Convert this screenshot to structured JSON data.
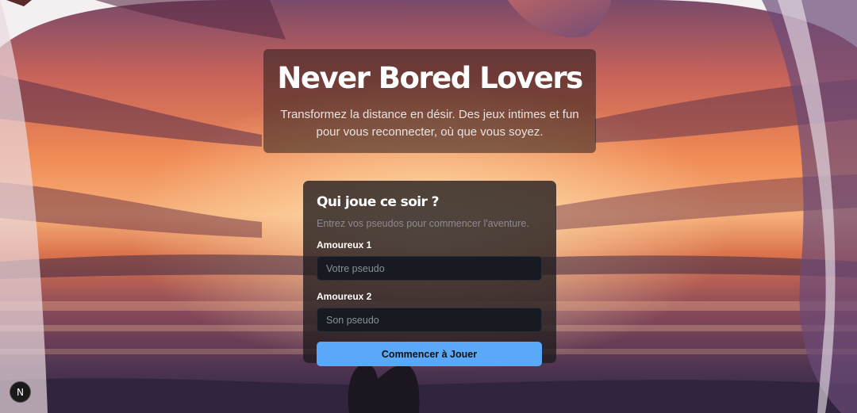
{
  "hero": {
    "title": "Never Bored Lovers",
    "subtitle": "Transformez la distance en désir. Des jeux intimes et fun pour vous reconnecter, où que vous soyez."
  },
  "form": {
    "title": "Qui joue ce soir ?",
    "subtitle": "Entrez vos pseudos pour commencer l'aventure.",
    "player1_label": "Amoureux 1",
    "player1_placeholder": "Votre pseudo",
    "player1_value": "",
    "player2_label": "Amoureux 2",
    "player2_placeholder": "Son pseudo",
    "player2_value": "",
    "submit_label": "Commencer à Jouer"
  },
  "badge": {
    "letter": "N",
    "icon": "nextjs-logo-icon"
  },
  "colors": {
    "accent": "#5aa8f8",
    "input_bg": "#171a20",
    "card_bg": "rgba(30,26,30,0.78)",
    "sunset_orange": "#e8734a",
    "sunset_purple": "#5a3e6e"
  }
}
